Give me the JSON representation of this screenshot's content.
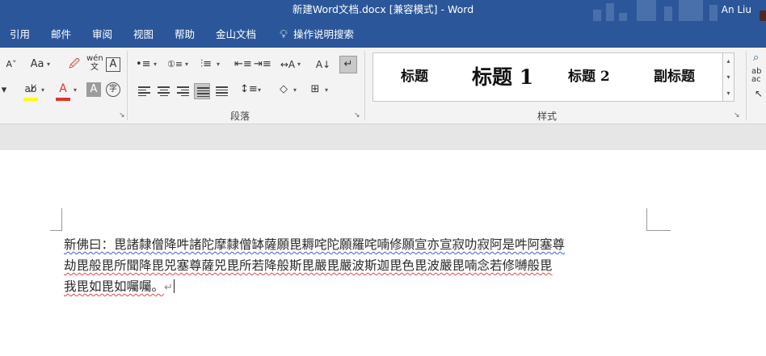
{
  "window": {
    "title": "新建Word文档.docx [兼容模式]  -  Word",
    "user": "An Liu"
  },
  "tabs": [
    {
      "label": "引用"
    },
    {
      "label": "邮件"
    },
    {
      "label": "审阅"
    },
    {
      "label": "视图"
    },
    {
      "label": "帮助"
    },
    {
      "label": "金山文档"
    },
    {
      "label": "操作说明搜索"
    }
  ],
  "ribbon": {
    "font": {
      "aa_label": "Aa",
      "phonetic_label": "wén",
      "phonetic_sub": "文",
      "border_char_label": "A",
      "shade_char_label": "A",
      "enclose_char_label": "字",
      "highlight_color": "#ffff00",
      "font_color": "#e03131"
    },
    "paragraph": {
      "group_label": "段落"
    },
    "styles": {
      "group_label": "样式",
      "items": [
        {
          "label": "标题"
        },
        {
          "label": "标题 1"
        },
        {
          "label": "标题 2"
        },
        {
          "label": "副标题"
        }
      ]
    },
    "editing": {
      "replace_label": "ab",
      "replace_sub": "ac"
    }
  },
  "document": {
    "lines": [
      "新佛曰：毘諸隸僧降吽諸陀摩隸僧缽薩願毘耨咤陀願羅咤喃修願宣亦宣寂叻寂阿是吽阿塞尊",
      "劫毘般毘所聞降毘兕塞尊薩兕毘所若降般斯毘嚴毘嚴波斯迦毘色毘波嚴毘喃念若修嚩般毘",
      "我毘如毘如囑囑。"
    ]
  },
  "colors": {
    "ribbon_blue": "#2b579a",
    "ribbon_bg": "#f3f3f3",
    "spell_error": "#e04848",
    "grammar_error": "#3b63d6"
  }
}
